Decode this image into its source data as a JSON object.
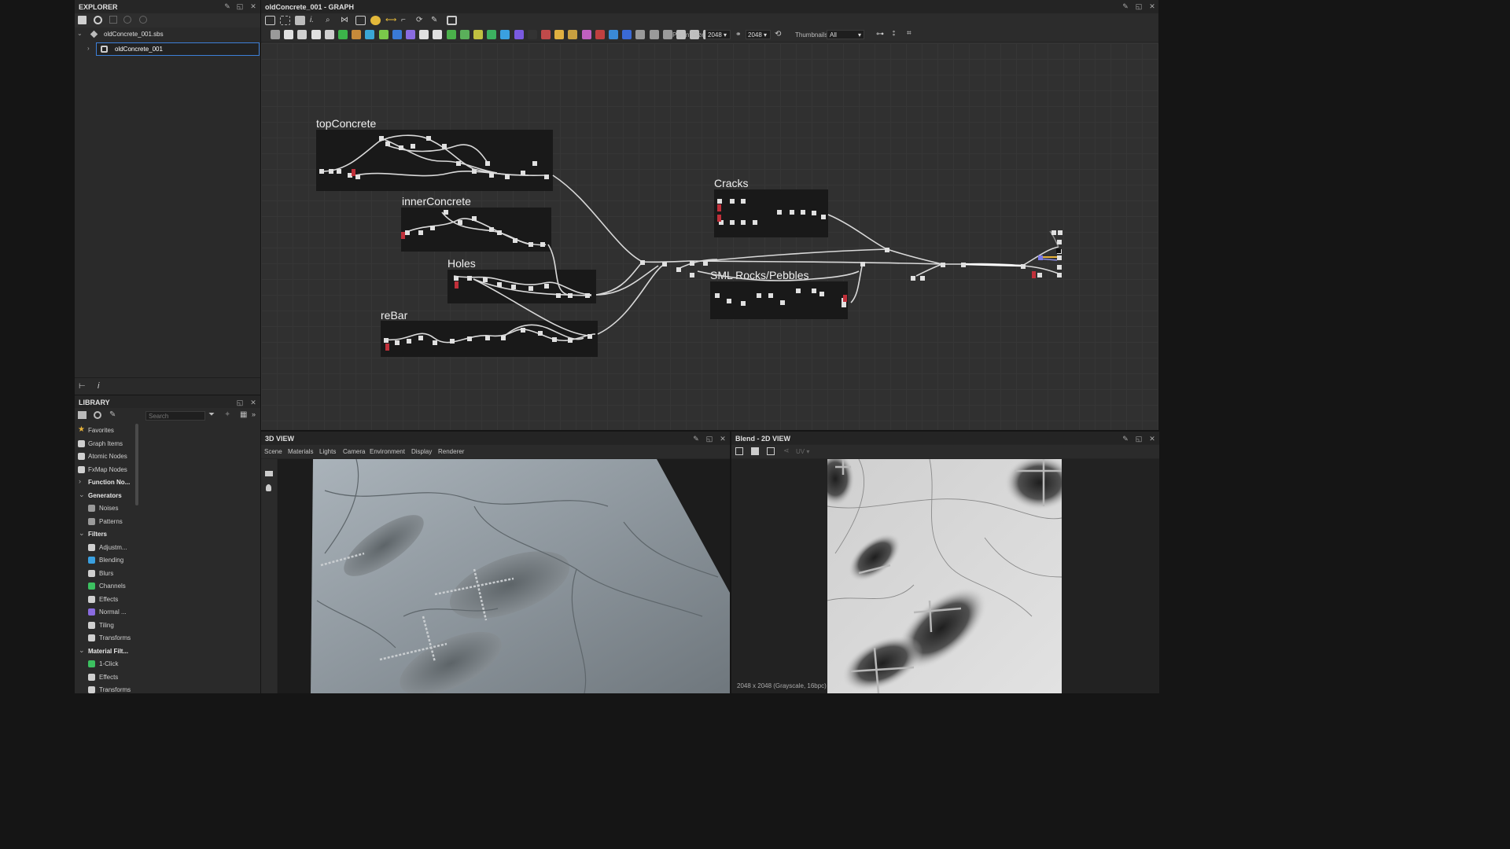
{
  "explorer": {
    "title": "EXPLORER",
    "file": "oldConcrete_001.sbs",
    "graph": "oldConcrete_001"
  },
  "library": {
    "title": "LIBRARY",
    "search_placeholder": "Search",
    "items": [
      {
        "label": "Favorites",
        "type": "item",
        "icon": "star-icon",
        "color": "#e8b33a"
      },
      {
        "label": "Graph Items",
        "type": "item",
        "icon": "comment-icon",
        "color": "#cfcfcf"
      },
      {
        "label": "Atomic Nodes",
        "type": "item",
        "icon": "nodes-icon",
        "color": "#cfcfcf"
      },
      {
        "label": "FxMap Nodes",
        "type": "item",
        "icon": "grid-icon",
        "color": "#cfcfcf"
      },
      {
        "label": "Function No...",
        "type": "header-collapsed"
      },
      {
        "label": "Generators",
        "type": "header"
      },
      {
        "label": "Noises",
        "type": "sub",
        "icon": "noise-icon",
        "color": "#9a9a9a"
      },
      {
        "label": "Patterns",
        "type": "sub",
        "icon": "pattern-icon",
        "color": "#9a9a9a"
      },
      {
        "label": "Filters",
        "type": "header"
      },
      {
        "label": "Adjustm...",
        "type": "sub",
        "icon": "adjust-icon",
        "color": "#cfcfcf"
      },
      {
        "label": "Blending",
        "type": "sub",
        "icon": "blend-icon",
        "color": "#3aa0e0"
      },
      {
        "label": "Blurs",
        "type": "sub",
        "icon": "drop-icon",
        "color": "#cfcfcf"
      },
      {
        "label": "Channels",
        "type": "sub",
        "icon": "layers-icon",
        "color": "#3cc060"
      },
      {
        "label": "Effects",
        "type": "sub",
        "icon": "wand-icon",
        "color": "#cfcfcf"
      },
      {
        "label": "Normal ...",
        "type": "sub",
        "icon": "normal-icon",
        "color": "#8a6be0"
      },
      {
        "label": "Tiling",
        "type": "sub",
        "icon": "tile-icon",
        "color": "#cfcfcf"
      },
      {
        "label": "Transforms",
        "type": "sub",
        "icon": "transform-icon",
        "color": "#cfcfcf"
      },
      {
        "label": "Material Filt...",
        "type": "header"
      },
      {
        "label": "1-Click",
        "type": "sub",
        "icon": "layers-icon",
        "color": "#3cc060"
      },
      {
        "label": "Effects",
        "type": "sub",
        "icon": "wand-icon",
        "color": "#cfcfcf"
      },
      {
        "label": "Transforms",
        "type": "sub",
        "icon": "transform-icon",
        "color": "#cfcfcf"
      }
    ]
  },
  "graph": {
    "title": "oldConcrete_001 - GRAPH",
    "parent_size_label": "Parent Size:",
    "parent_size_value": "2048",
    "size_value": "2048",
    "thumbnails_label": "Thumbnails:",
    "thumbnails_value": "All",
    "frames": [
      {
        "id": "topConcrete",
        "title": "topConcrete"
      },
      {
        "id": "innerConcrete",
        "title": "innerConcrete"
      },
      {
        "id": "holes",
        "title": "Holes"
      },
      {
        "id": "rebar",
        "title": "reBar"
      },
      {
        "id": "cracks",
        "title": "Cracks"
      },
      {
        "id": "rocks",
        "title": "SML Rocks/Pebbles"
      }
    ]
  },
  "view3d": {
    "title": "3D VIEW",
    "menu": [
      "Scene",
      "Materials",
      "Lights",
      "Camera",
      "Environment",
      "Display",
      "Renderer"
    ]
  },
  "view2d": {
    "title": "Blend - 2D VIEW",
    "uv_label": "UV",
    "status": "2048 x 2048 (Grayscale, 16bpc)"
  }
}
